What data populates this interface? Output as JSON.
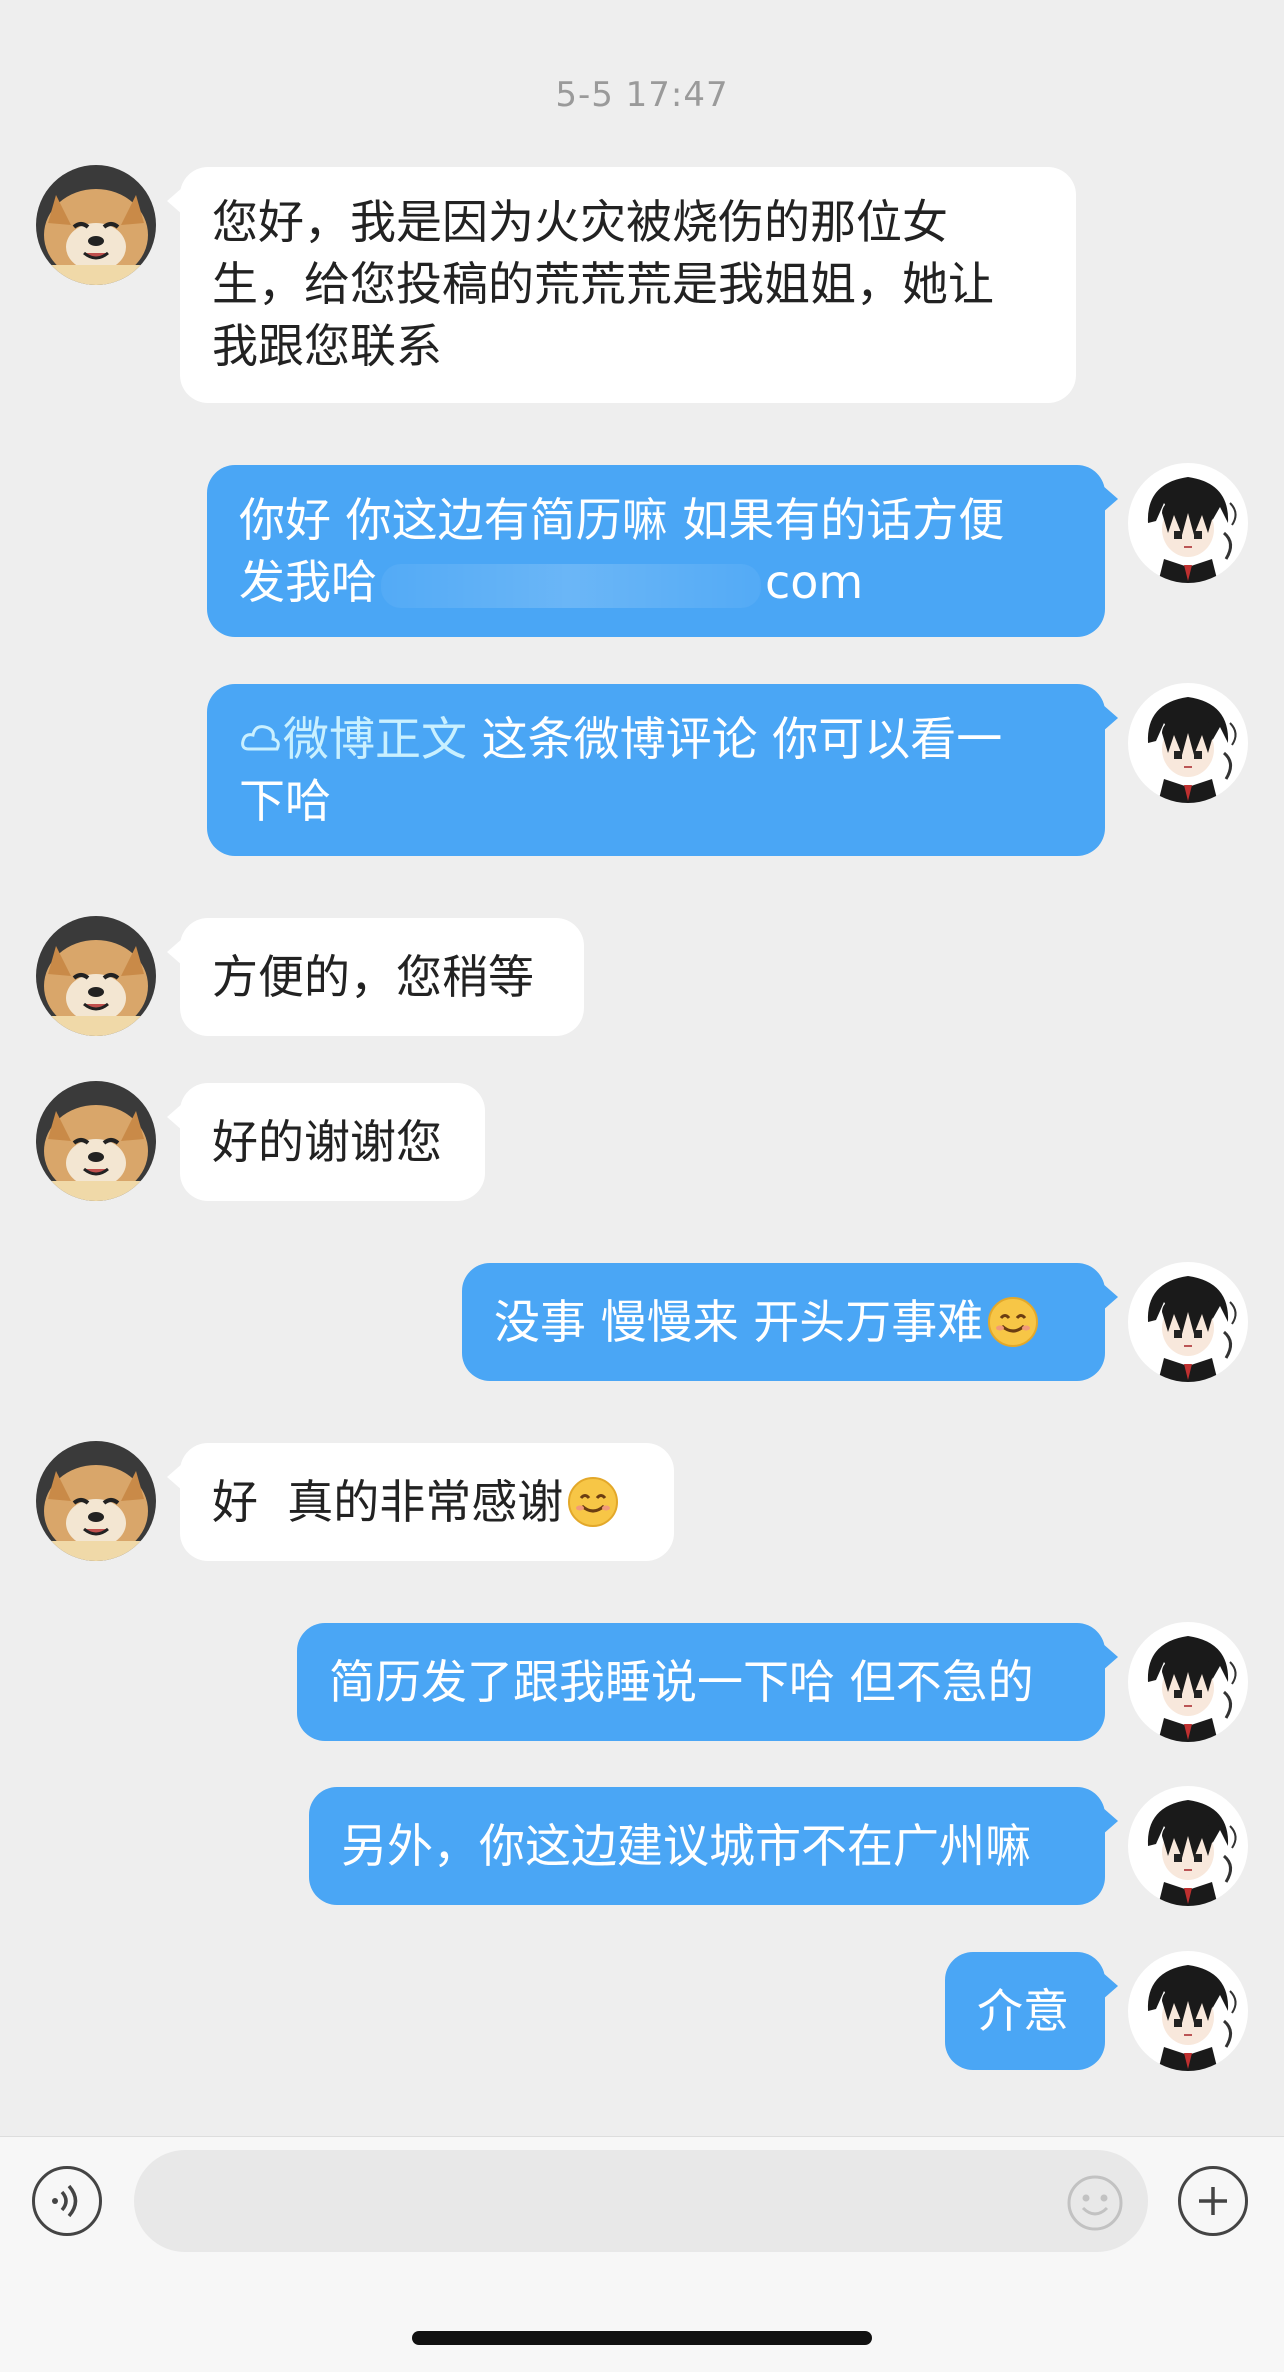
{
  "timestamp": "5-5 17:47",
  "messages": [
    {
      "side": "in",
      "lines": [
        "您好，我是因为火灾被烧伤的那位女",
        "生，给您投稿的荒荒荒是我姐姐，她让",
        "我跟您联系"
      ]
    },
    {
      "side": "out",
      "line1": "你好 你这边有简历嘛 如果有的话方便",
      "line2_pre": "发我哈",
      "line2_post": "com"
    },
    {
      "side": "out",
      "link_label": "微博正文",
      "line1_rest": " 这条微博评论 你可以看一",
      "line2": "下哈"
    },
    {
      "side": "in",
      "text": "方便的，您稍等"
    },
    {
      "side": "in",
      "text": "好的谢谢您"
    },
    {
      "side": "out",
      "text": "没事 慢慢来 开头万事难"
    },
    {
      "side": "in",
      "text": "好  真的非常感谢"
    },
    {
      "side": "out",
      "text": "简历发了跟我睡说一下哈 但不急的"
    },
    {
      "side": "out",
      "text": "另外，你这边建议城市不在广州嘛"
    },
    {
      "side": "out",
      "text": "介意"
    }
  ],
  "icons": {
    "voice": "voice-icon",
    "emoji": "smiley-face-icon",
    "plus": "plus-icon",
    "emoji_in_message": "smiling-emoji-icon",
    "link": "cloud-icon"
  },
  "colors": {
    "outgoing_bubble": "#4aa6f5",
    "incoming_bubble": "#ffffff",
    "background": "#eeeeee"
  },
  "input": {
    "value": "",
    "placeholder": ""
  }
}
